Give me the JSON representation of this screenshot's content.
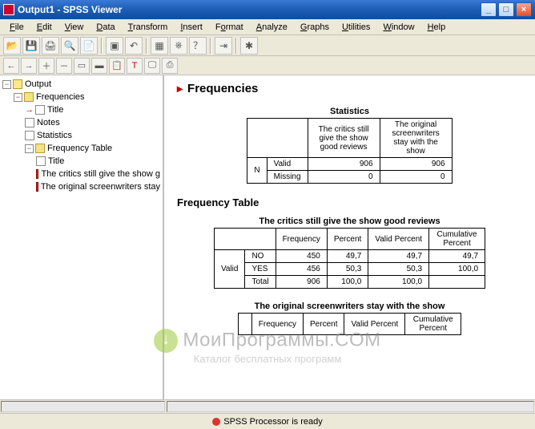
{
  "window": {
    "title": "Output1 - SPSS Viewer",
    "min": "_",
    "max": "□",
    "close": "×"
  },
  "menu": {
    "file": "File",
    "edit": "Edit",
    "view": "View",
    "data": "Data",
    "transform": "Transform",
    "insert": "Insert",
    "format": "Format",
    "analyze": "Analyze",
    "graphs": "Graphs",
    "utilities": "Utilities",
    "window": "Window",
    "help": "Help"
  },
  "tree": {
    "root": "Output",
    "freq": "Frequencies",
    "title": "Title",
    "notes": "Notes",
    "stats": "Statistics",
    "ftable": "Frequency Table",
    "title2": "Title",
    "critics": "The critics still give the show g",
    "writers": "The original screenwriters stay"
  },
  "main": {
    "h1": "Frequencies",
    "h2": "Frequency Table",
    "stats_title": "Statistics",
    "stats_cols": {
      "c1": "The critics still give the show good reviews",
      "c2": "The original screenwriters stay with the show"
    },
    "stats_rows": {
      "n": "N",
      "valid": "Valid",
      "missing": "Missing",
      "v1": "906",
      "v2": "906",
      "m1": "0",
      "m2": "0"
    },
    "ft1_title": "The critics still give the show good reviews",
    "ft2_title": "The original screenwriters stay with the show",
    "cols": {
      "freq": "Frequency",
      "pct": "Percent",
      "vpct": "Valid Percent",
      "cpct": "Cumulative Percent"
    },
    "rows": {
      "valid": "Valid",
      "no": "NO",
      "yes": "YES",
      "total": "Total",
      "r1": {
        "f": "450",
        "p": "49,7",
        "vp": "49,7",
        "cp": "49,7"
      },
      "r2": {
        "f": "456",
        "p": "50,3",
        "vp": "50,3",
        "cp": "100,0"
      },
      "r3": {
        "f": "906",
        "p": "100,0",
        "vp": "100,0",
        "cp": ""
      }
    }
  },
  "status": {
    "text": "SPSS Processor   is ready"
  },
  "watermark": {
    "big": "МоиПрограммы.COM",
    "small": "Каталог бесплатных программ"
  }
}
